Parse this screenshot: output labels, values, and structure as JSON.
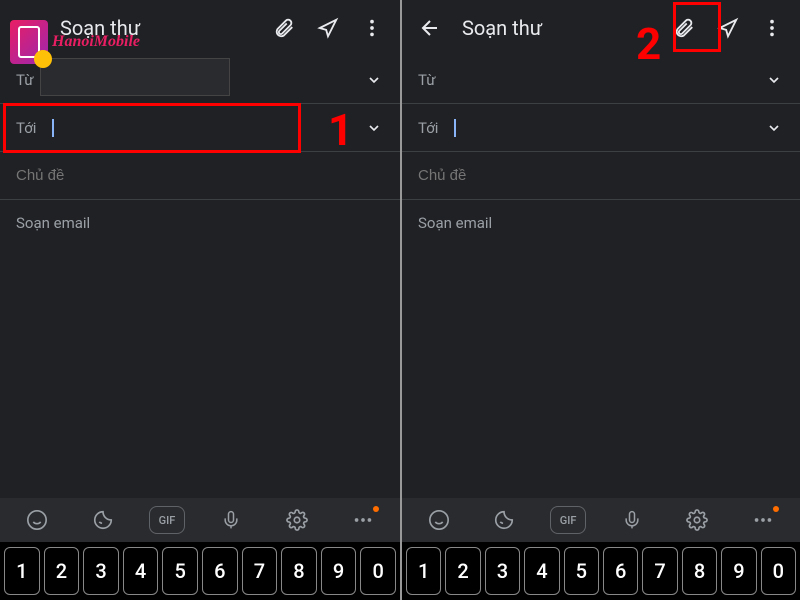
{
  "header": {
    "title": "Soạn thư"
  },
  "fields": {
    "from_label": "Từ",
    "to_label": "Tới",
    "subject_placeholder": "Chủ đề",
    "body_placeholder": "Soạn email"
  },
  "keyboard": {
    "keys": [
      "1",
      "2",
      "3",
      "4",
      "5",
      "6",
      "7",
      "8",
      "9",
      "0"
    ],
    "gif_label": "GIF"
  },
  "annotations": {
    "step1": "1",
    "step2": "2"
  },
  "logo": {
    "text": "HanoiMobile"
  }
}
